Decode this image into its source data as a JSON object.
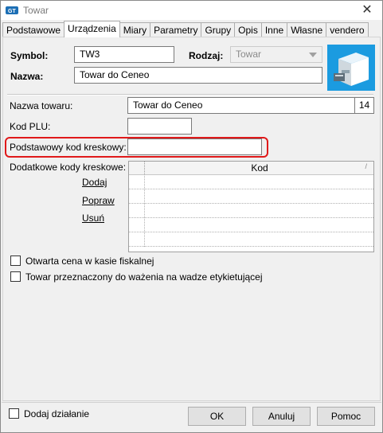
{
  "window": {
    "title": "Towar",
    "close_glyph": "✕"
  },
  "tabs": [
    {
      "label": "Podstawowe"
    },
    {
      "label": "Urządzenia",
      "active": true
    },
    {
      "label": "Miary"
    },
    {
      "label": "Parametry"
    },
    {
      "label": "Grupy"
    },
    {
      "label": "Opis"
    },
    {
      "label": "Inne"
    },
    {
      "label": "Własne"
    },
    {
      "label": "vendero"
    }
  ],
  "header": {
    "symbol_label": "Symbol:",
    "symbol_value": "TW3",
    "rodzaj_label": "Rodzaj:",
    "rodzaj_value": "Towar",
    "nazwa_label": "Nazwa:",
    "nazwa_value": "Towar do Ceneo",
    "product_icon": "product-box-icon"
  },
  "device": {
    "nazwa_towaru_label": "Nazwa towaru:",
    "nazwa_towaru_value": "Towar do Ceneo",
    "nazwa_towaru_count": "14",
    "kod_plu_label": "Kod PLU:",
    "kod_plu_value": "",
    "podstawowy_kod_label": "Podstawowy kod kreskowy:",
    "podstawowy_kod_value": "",
    "dodatkowe_label": "Dodatkowe kody kreskowe:",
    "links": {
      "dodaj": "Dodaj",
      "popraw": "Popraw",
      "usun": "Usuń"
    },
    "grid": {
      "column": "Kod",
      "rows": [
        "",
        "",
        "",
        "",
        ""
      ]
    },
    "checkbox_cena": "Otwarta cena w kasie fiskalnej",
    "checkbox_waga": "Towar przeznaczony do ważenia na wadze etykietującej"
  },
  "footer": {
    "dodaj_dzialanie": "Dodaj działanie",
    "ok": "OK",
    "anuluj": "Anuluj",
    "pomoc": "Pomoc"
  },
  "colors": {
    "highlight": "#e0191a",
    "accent": "#0078d7"
  }
}
